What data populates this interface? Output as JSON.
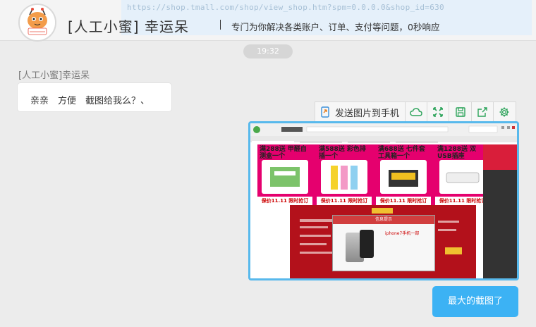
{
  "header": {
    "url_overlay_text": "https://shop.tmall.com/shop/view_shop.htm?spm=0.0.0.0&shop_id=630",
    "shop_name": "[人工小蜜] 幸运呆",
    "slogan": "专门为你解决各类账户、订单、支付等问题，0秒响应",
    "avatar_icon": "mascot-avatar-icon"
  },
  "timestamp": "19:32",
  "messages": [
    {
      "sender": "[人工小蜜]幸运呆",
      "text": "亲亲　方便　截图给我么？、"
    }
  ],
  "image_toolbar": {
    "send_label": "发送图片到手机",
    "icons": [
      "cloud-icon",
      "fullscreen-icon",
      "save-icon",
      "share-icon",
      "gear-icon"
    ],
    "accent": "#3cb2f4"
  },
  "screenshot": {
    "promos": [
      {
        "title": "满288送 甲醛自测盒一个",
        "foot": "保价11.11 限时抢订"
      },
      {
        "title": "满588送 彩色排插一个",
        "foot": "保价11.11 限时抢订"
      },
      {
        "title": "满688送 七件套工具箱一个",
        "foot": "保价11.11 限时抢订"
      },
      {
        "title": "满1288送 双USB插座",
        "foot": "保价11.11 限时抢订"
      }
    ],
    "dialog_title": "信息提示",
    "dialog_text": "iphone7手机一部"
  },
  "reply": {
    "text": "最大的截图了"
  }
}
